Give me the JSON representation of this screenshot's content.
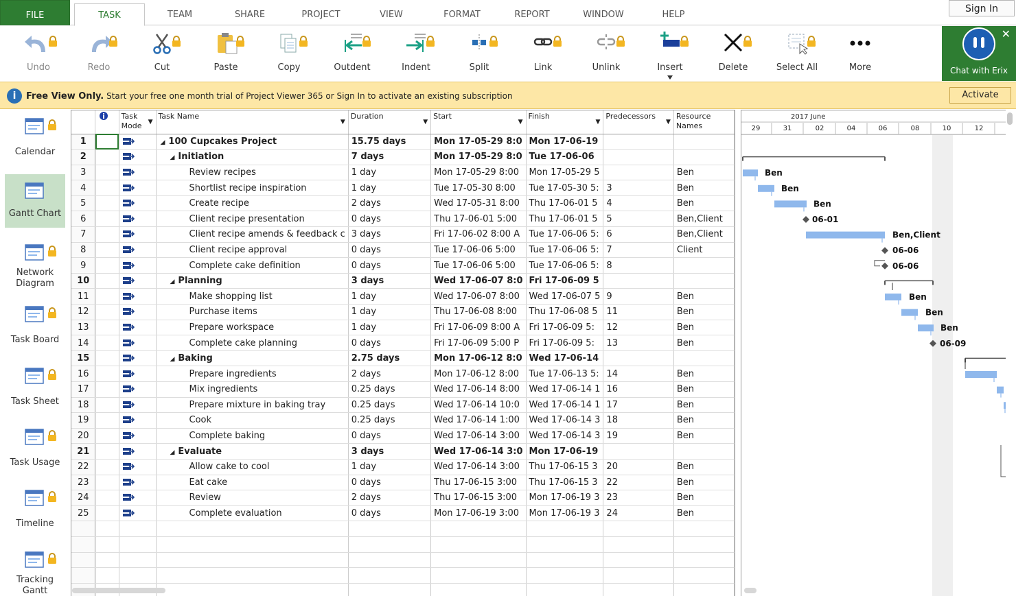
{
  "tabs": [
    {
      "label": "FILE"
    },
    {
      "label": "TASK"
    },
    {
      "label": "TEAM"
    },
    {
      "label": "SHARE"
    },
    {
      "label": "PROJECT"
    },
    {
      "label": "VIEW"
    },
    {
      "label": "FORMAT"
    },
    {
      "label": "REPORT"
    },
    {
      "label": "WINDOW"
    },
    {
      "label": "HELP"
    }
  ],
  "active_tab": "TASK",
  "signin_label": "Sign In",
  "ribbon": {
    "undo": "Undo",
    "redo": "Redo",
    "cut": "Cut",
    "paste": "Paste",
    "copy": "Copy",
    "outdent": "Outdent",
    "indent": "Indent",
    "split": "Split",
    "link": "Link",
    "unlink": "Unlink",
    "insert": "Insert",
    "delete": "Delete",
    "select_all": "Select All",
    "more": "More"
  },
  "chat": {
    "label": "Chat with Erix"
  },
  "banner": {
    "bold": "Free View Only.",
    "text": " Start your free one month trial of Project Viewer 365 or Sign In to activate an existing subscription",
    "activate": "Activate"
  },
  "sidebar": [
    {
      "label": "Calendar"
    },
    {
      "label": "Gantt Chart"
    },
    {
      "label": "Network Diagram"
    },
    {
      "label": "Task Board"
    },
    {
      "label": "Task Sheet"
    },
    {
      "label": "Task Usage"
    },
    {
      "label": "Timeline"
    },
    {
      "label": "Tracking Gantt"
    }
  ],
  "columns": {
    "mode": "Task Mode",
    "name": "Task Name",
    "duration": "Duration",
    "start": "Start",
    "finish": "Finish",
    "pred": "Predecessors",
    "res": "Resource Names"
  },
  "rows": [
    {
      "id": "1",
      "indent": 0,
      "summary": true,
      "name": "100 Cupcakes Project",
      "duration": "15.75 days",
      "start": "Mon 17-05-29 8:0",
      "finish": "Mon 17-06-19",
      "pred": "",
      "res": ""
    },
    {
      "id": "2",
      "indent": 1,
      "summary": true,
      "name": "Initiation",
      "duration": "7 days",
      "start": "Mon 17-05-29 8:0",
      "finish": "Tue 17-06-06",
      "pred": "",
      "res": ""
    },
    {
      "id": "3",
      "indent": 2,
      "summary": false,
      "name": "Review recipes",
      "duration": "1 day",
      "start": "Mon 17-05-29 8:00",
      "finish": "Mon 17-05-29 5",
      "pred": "",
      "res": "Ben"
    },
    {
      "id": "4",
      "indent": 2,
      "summary": false,
      "name": "Shortlist recipe inspiration",
      "duration": "1 day",
      "start": "Tue 17-05-30 8:00",
      "finish": "Tue 17-05-30 5:",
      "pred": "3",
      "res": "Ben"
    },
    {
      "id": "5",
      "indent": 2,
      "summary": false,
      "name": "Create recipe",
      "duration": "2 days",
      "start": "Wed 17-05-31 8:00",
      "finish": "Thu 17-06-01 5",
      "pred": "4",
      "res": "Ben"
    },
    {
      "id": "6",
      "indent": 2,
      "summary": false,
      "name": "Client recipe presentation",
      "duration": "0 days",
      "start": "Thu 17-06-01 5:00",
      "finish": "Thu 17-06-01 5",
      "pred": "5",
      "res": "Ben,Client"
    },
    {
      "id": "7",
      "indent": 2,
      "summary": false,
      "name": "Client recipe amends & feedback c",
      "duration": "3 days",
      "start": "Fri 17-06-02 8:00 A",
      "finish": "Tue 17-06-06 5:",
      "pred": "6",
      "res": "Ben,Client"
    },
    {
      "id": "8",
      "indent": 2,
      "summary": false,
      "name": "Client recipe approval",
      "duration": "0 days",
      "start": "Tue 17-06-06 5:00",
      "finish": "Tue 17-06-06 5:",
      "pred": "7",
      "res": "Client"
    },
    {
      "id": "9",
      "indent": 2,
      "summary": false,
      "name": "Complete cake definition",
      "duration": "0 days",
      "start": "Tue 17-06-06 5:00",
      "finish": "Tue 17-06-06 5:",
      "pred": "8",
      "res": ""
    },
    {
      "id": "10",
      "indent": 1,
      "summary": true,
      "name": "Planning",
      "duration": "3 days",
      "start": "Wed 17-06-07 8:0",
      "finish": "Fri 17-06-09 5",
      "pred": "",
      "res": ""
    },
    {
      "id": "11",
      "indent": 2,
      "summary": false,
      "name": "Make shopping list",
      "duration": "1 day",
      "start": "Wed 17-06-07 8:00",
      "finish": "Wed 17-06-07 5",
      "pred": "9",
      "res": "Ben"
    },
    {
      "id": "12",
      "indent": 2,
      "summary": false,
      "name": "Purchase items",
      "duration": "1 day",
      "start": "Thu 17-06-08 8:00",
      "finish": "Thu 17-06-08 5",
      "pred": "11",
      "res": "Ben"
    },
    {
      "id": "13",
      "indent": 2,
      "summary": false,
      "name": "Prepare workspace",
      "duration": "1 day",
      "start": "Fri 17-06-09 8:00 A",
      "finish": "Fri 17-06-09 5:",
      "pred": "12",
      "res": "Ben"
    },
    {
      "id": "14",
      "indent": 2,
      "summary": false,
      "name": "Complete cake planning",
      "duration": "0 days",
      "start": "Fri 17-06-09 5:00 P",
      "finish": "Fri 17-06-09 5:",
      "pred": "13",
      "res": "Ben"
    },
    {
      "id": "15",
      "indent": 1,
      "summary": true,
      "name": "Baking",
      "duration": "2.75 days",
      "start": "Mon 17-06-12 8:0",
      "finish": "Wed 17-06-14",
      "pred": "",
      "res": ""
    },
    {
      "id": "16",
      "indent": 2,
      "summary": false,
      "name": "Prepare ingredients",
      "duration": "2 days",
      "start": "Mon 17-06-12 8:00",
      "finish": "Tue 17-06-13 5:",
      "pred": "14",
      "res": "Ben"
    },
    {
      "id": "17",
      "indent": 2,
      "summary": false,
      "name": "Mix ingredients",
      "duration": "0.25 days",
      "start": "Wed 17-06-14 8:00",
      "finish": "Wed 17-06-14 1",
      "pred": "16",
      "res": "Ben"
    },
    {
      "id": "18",
      "indent": 2,
      "summary": false,
      "name": "Prepare mixture in baking tray",
      "duration": "0.25 days",
      "start": "Wed 17-06-14 10:0",
      "finish": "Wed 17-06-14 1",
      "pred": "17",
      "res": "Ben"
    },
    {
      "id": "19",
      "indent": 2,
      "summary": false,
      "name": "Cook",
      "duration": "0.25 days",
      "start": "Wed 17-06-14 1:00",
      "finish": "Wed 17-06-14 3",
      "pred": "18",
      "res": "Ben"
    },
    {
      "id": "20",
      "indent": 2,
      "summary": false,
      "name": "Complete baking",
      "duration": "0 days",
      "start": "Wed 17-06-14 3:00",
      "finish": "Wed 17-06-14 3",
      "pred": "19",
      "res": "Ben"
    },
    {
      "id": "21",
      "indent": 1,
      "summary": true,
      "name": "Evaluate",
      "duration": "3 days",
      "start": "Wed 17-06-14 3:0",
      "finish": "Mon 17-06-19",
      "pred": "",
      "res": ""
    },
    {
      "id": "22",
      "indent": 2,
      "summary": false,
      "name": "Allow cake to cool",
      "duration": "1 day",
      "start": "Wed 17-06-14 3:00",
      "finish": "Thu 17-06-15 3",
      "pred": "20",
      "res": "Ben"
    },
    {
      "id": "23",
      "indent": 2,
      "summary": false,
      "name": "Eat cake",
      "duration": "0 days",
      "start": "Thu 17-06-15 3:00",
      "finish": "Thu 17-06-15 3",
      "pred": "22",
      "res": "Ben"
    },
    {
      "id": "24",
      "indent": 2,
      "summary": false,
      "name": "Review",
      "duration": "2 days",
      "start": "Thu 17-06-15 3:00",
      "finish": "Mon 17-06-19 3",
      "pred": "23",
      "res": "Ben"
    },
    {
      "id": "25",
      "indent": 2,
      "summary": false,
      "name": "Complete evaluation",
      "duration": "0 days",
      "start": "Mon 17-06-19 3:00",
      "finish": "Mon 17-06-19 3",
      "pred": "24",
      "res": "Ben"
    }
  ],
  "gantt": {
    "month": "2017 June",
    "days": [
      "29",
      "31",
      "02",
      "04",
      "06",
      "08",
      "10",
      "12"
    ],
    "labels": [
      {
        "row": 3,
        "text": "Ben"
      },
      {
        "row": 4,
        "text": "Ben"
      },
      {
        "row": 5,
        "text": "Ben"
      },
      {
        "row": 6,
        "text": "06-01"
      },
      {
        "row": 7,
        "text": "Ben,Client"
      },
      {
        "row": 8,
        "text": "06-06"
      },
      {
        "row": 9,
        "text": "06-06"
      },
      {
        "row": 11,
        "text": "Ben"
      },
      {
        "row": 12,
        "text": "Ben"
      },
      {
        "row": 13,
        "text": "Ben"
      },
      {
        "row": 14,
        "text": "06-09"
      }
    ]
  },
  "colors": {
    "accent": "#2e7d32",
    "banner": "#fde7a6",
    "bar": "#8fb8ec",
    "selected_view": "#c8e0c8"
  }
}
